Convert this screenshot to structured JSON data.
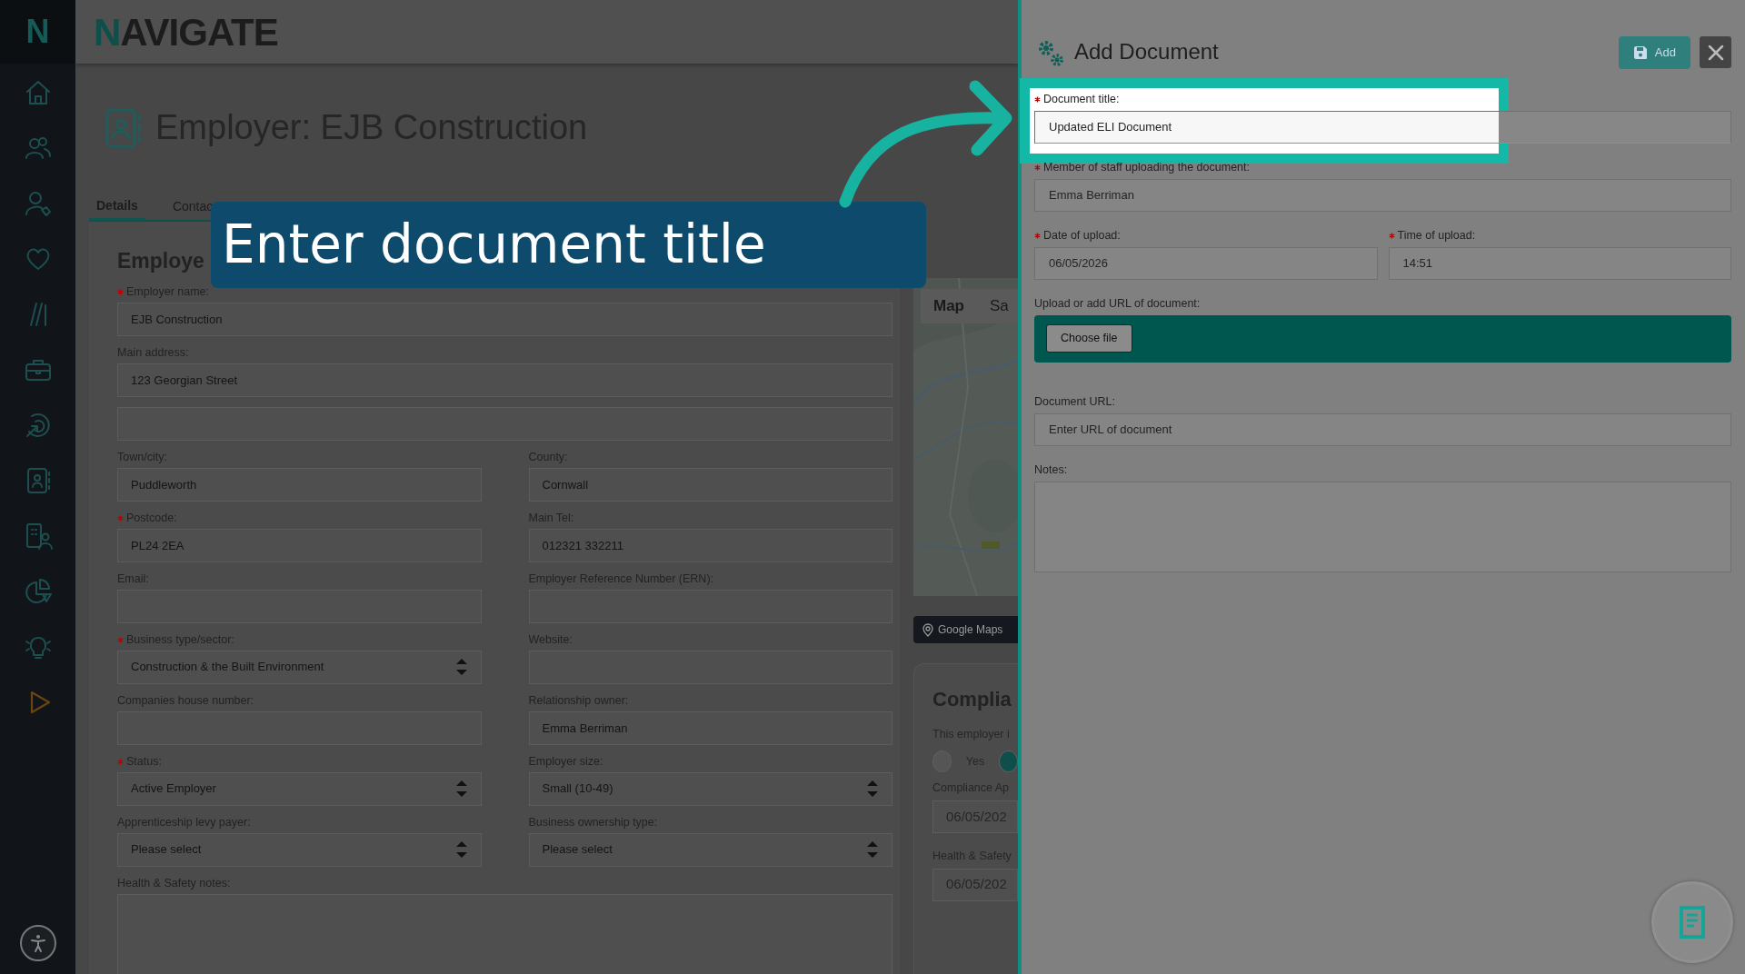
{
  "app": {
    "logo_mark": "N",
    "logo": "NAVIGATE"
  },
  "page": {
    "title": "Employer: EJB Construction",
    "tabs": [
      {
        "label": "Details",
        "selected": true
      },
      {
        "label": "Contac",
        "selected": false
      }
    ]
  },
  "callout": {
    "text": "Enter document title"
  },
  "employer_form": {
    "heading": "Employe",
    "rows": [
      [
        {
          "label": "Employer name:",
          "required": true,
          "value": "EJB Construction",
          "kind": "text"
        }
      ],
      [
        {
          "label": "Main address:",
          "required": false,
          "value": "123 Georgian Street",
          "kind": "text"
        }
      ],
      [
        {
          "kind": "text"
        }
      ],
      [
        {
          "label": "Town/city:",
          "required": false,
          "value": "Puddleworth",
          "kind": "text"
        },
        {
          "label": "County:",
          "required": false,
          "value": "Cornwall",
          "kind": "text"
        }
      ],
      [
        {
          "label": "Postcode:",
          "required": true,
          "value": "PL24 2EA",
          "kind": "text"
        },
        {
          "label": "Main Tel:",
          "required": false,
          "value": "012321 332211",
          "kind": "text"
        }
      ],
      [
        {
          "label": "Email:",
          "required": false,
          "kind": "text"
        },
        {
          "label": "Employer Reference Number (ERN):",
          "required": false,
          "kind": "text"
        }
      ],
      [
        {
          "label": "Business type/sector:",
          "required": true,
          "value": "Construction & the Built Environment",
          "kind": "select"
        },
        {
          "label": "Website:",
          "required": false,
          "kind": "text"
        }
      ],
      [
        {
          "label": "Companies house number:",
          "required": false,
          "kind": "text"
        },
        {
          "label": "Relationship owner:",
          "required": false,
          "value": "Emma Berriman",
          "kind": "text"
        }
      ],
      [
        {
          "label": "Status:",
          "required": true,
          "value": "Active Employer",
          "kind": "select"
        },
        {
          "label": "Employer size:",
          "required": false,
          "value": "Small (10-49)",
          "kind": "select"
        }
      ],
      [
        {
          "label": "Apprenticeship levy payer:",
          "required": false,
          "value": "Please select",
          "kind": "select"
        },
        {
          "label": "Business ownership type:",
          "required": false,
          "value": "Please select",
          "kind": "select"
        }
      ],
      [
        {
          "label": "Health & Safety notes:",
          "required": false,
          "kind": "textarea"
        }
      ]
    ]
  },
  "map": {
    "kind": "picture",
    "buttons": [
      {
        "label": "Map",
        "selected": true
      },
      {
        "label": "Sa",
        "selected": false
      }
    ],
    "link": "Google Maps"
  },
  "compliance": {
    "heading": "Complia",
    "question": "This employer i",
    "options": [
      {
        "label": "Yes",
        "selected": false
      },
      {
        "selected": true
      }
    ],
    "fields": [
      {
        "label": "Compliance Ap",
        "value": "06/05/202"
      },
      {
        "label": "Health & Safety",
        "value": "06/05/202"
      }
    ]
  },
  "panel": {
    "title": "Add Document",
    "add_button": "Add",
    "rows": [
      [
        {
          "label": "Document title:",
          "required": true,
          "value": "Updated ELI Document",
          "kind": "text",
          "highlighted": true
        }
      ],
      [
        {
          "label": "Member of staff uploading the document:",
          "required": true,
          "value": "Emma Berriman",
          "kind": "text",
          "highlighted": false
        }
      ],
      [
        {
          "label": "Date of upload:",
          "required": true,
          "value": "06/05/2026",
          "kind": "text",
          "highlighted": false
        },
        {
          "label": "Time of upload:",
          "required": true,
          "value": "14:51",
          "kind": "text",
          "highlighted": false
        }
      ],
      [
        {
          "label": "Upload or add URL of document:",
          "required": false,
          "kind": "file",
          "button": "Choose file",
          "highlighted": false
        }
      ],
      [
        {
          "label": "Document URL:",
          "required": false,
          "placeholder": "Enter URL of document",
          "kind": "text",
          "highlighted": false
        }
      ],
      [
        {
          "label": "Notes:",
          "required": false,
          "kind": "textarea",
          "highlighted": false
        }
      ]
    ]
  }
}
